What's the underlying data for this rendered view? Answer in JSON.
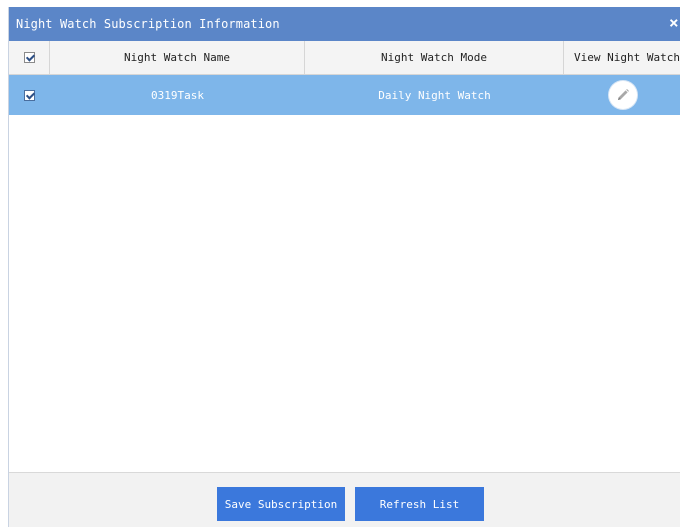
{
  "dialog": {
    "title": "Night Watch Subscription Information",
    "close_icon": "×"
  },
  "table": {
    "columns": [
      "",
      "Night Watch Name",
      "Night Watch Mode",
      "View Night Watch"
    ],
    "select_all_checked": true,
    "rows": [
      {
        "checked": true,
        "name": "0319Task",
        "mode": "Daily Night Watch",
        "action_icon": "pencil-edit-icon"
      }
    ]
  },
  "footer": {
    "save_label": "Save Subscription",
    "refresh_label": "Refresh List"
  },
  "colors": {
    "titlebar": "#5b86c8",
    "selected_row": "#7eb6ea",
    "button": "#3b78dc",
    "footer": "#f2f2f2"
  }
}
